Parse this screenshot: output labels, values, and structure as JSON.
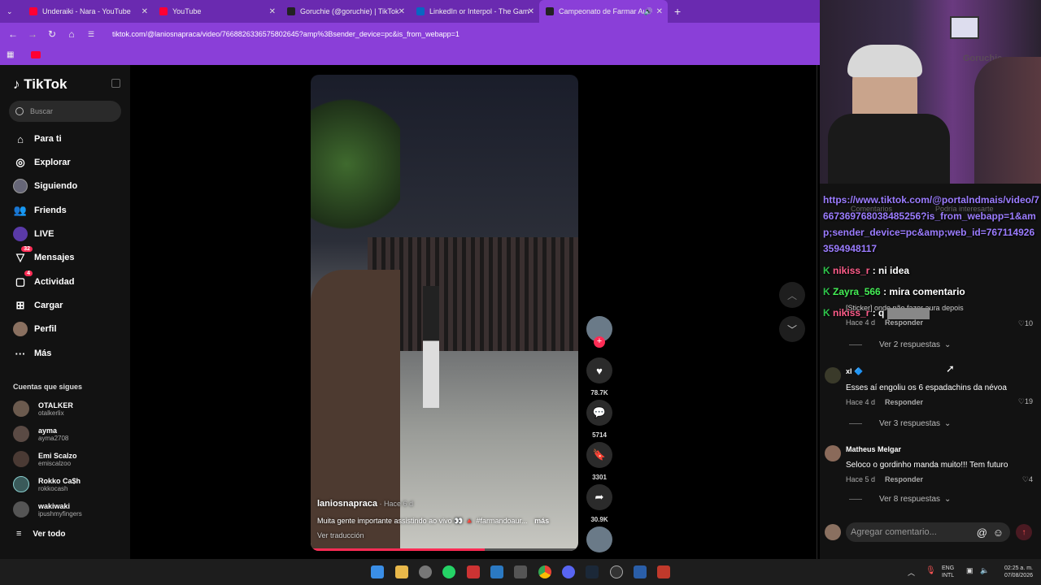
{
  "tabs": [
    {
      "title": "Underaiki - Nara - YouTube",
      "color": "#ff0033"
    },
    {
      "title": "YouTube",
      "color": "#ff0033"
    },
    {
      "title": "Goruchie (@goruchie) | TikTok",
      "color": "#222222"
    },
    {
      "title": "LinkedIn or Interpol - The Gam",
      "color": "#0a66c2"
    },
    {
      "title": "Campeonato de Farmar Aur",
      "color": "#222222"
    }
  ],
  "address": {
    "url": "tiktok.com/@laniosnapraca/video/7668826336575802645?amp%3Bsender_device=pc&is_from_webapp=1"
  },
  "sidebar": {
    "logo": "TikTok",
    "search_placeholder": "Buscar",
    "items": [
      {
        "label": "Para ti",
        "icon": "home-icon"
      },
      {
        "label": "Explorar",
        "icon": "compass-icon"
      },
      {
        "label": "Siguiendo",
        "icon": "following-avatar-icon"
      },
      {
        "label": "Friends",
        "icon": "friends-icon"
      },
      {
        "label": "LIVE",
        "icon": "live-icon"
      },
      {
        "label": "Mensajes",
        "icon": "message-icon",
        "badge": "32"
      },
      {
        "label": "Actividad",
        "icon": "activity-icon",
        "badge": "4"
      },
      {
        "label": "Cargar",
        "icon": "upload-icon"
      },
      {
        "label": "Perfil",
        "icon": "profile-icon"
      },
      {
        "label": "Más",
        "icon": "more-icon"
      }
    ],
    "following_title": "Cuentas que sigues",
    "accounts": [
      {
        "name": "OTALKER",
        "handle": "otalkerlix"
      },
      {
        "name": "ayma",
        "handle": "ayma2708"
      },
      {
        "name": "Emi Scalzo",
        "handle": "emiscalzoo"
      },
      {
        "name": "Rokko Ca$h",
        "handle": "rokkocash"
      },
      {
        "name": "wakiwaki",
        "handle": "ipushmyfingers"
      }
    ],
    "see_all": "Ver todo"
  },
  "video": {
    "author": "laniosnapraca",
    "age": " · Hace 6 d",
    "caption": "Muita gente importante assistindo ao vivo 👀 🔺 #farmandoaur...",
    "more": "más",
    "translate": "Ver traducción",
    "progress": 0.65
  },
  "actions": {
    "likes": "78.7K",
    "comments": "5714",
    "saves": "3301",
    "shares": "30.9K"
  },
  "overlay_chat": {
    "link": "https://www.tiktok.com/@portalndmais/video/7667369768038485256?is_from_webapp=1&amp;sender_device=pc&amp;web_id=7671149263594948117",
    "lines": [
      {
        "user": "nikiss_r",
        "text": " : ni idea",
        "color": "#ff5c8a"
      },
      {
        "user": "Zayra_566",
        "text": " : mira comentario",
        "color": "#44ee55"
      },
      {
        "user": "nikiss_r",
        "text": " : q",
        "color": "#ff5c8a"
      }
    ],
    "ghost_tabs": {
      "left": "Comentarios",
      "right": "Podría interesarte"
    },
    "sticker": "[Sticker] onde não fazer aura depois"
  },
  "comments": [
    {
      "meta": "Hace 4 d",
      "reply": "Responder",
      "likes": "10",
      "more": "Ver 2 respuestas"
    },
    {
      "name": "xl 🔷",
      "text": "Esses aí engoliu os 6 espadachins da névoa",
      "meta": "Hace 4 d",
      "reply": "Responder",
      "likes": "19",
      "more": "Ver 3 respuestas"
    },
    {
      "name": "Matheus Melgar",
      "text": "Seloco o gordinho manda muito!!! Tem futuro",
      "meta": "Hace 5 d",
      "reply": "Responder",
      "likes": "4",
      "more": "Ver 8 respuestas"
    }
  ],
  "add_comment": {
    "placeholder": "Agregar comentario..."
  },
  "taskbar": {
    "lang": "ENG",
    "layout": "INTL",
    "time": "02:25 a. m.",
    "date": "07/08/2026"
  },
  "webcam": {
    "label": "Goruchie"
  }
}
